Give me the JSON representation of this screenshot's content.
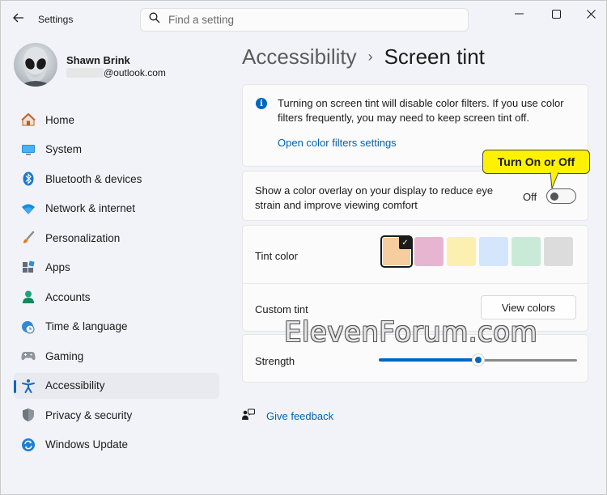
{
  "window": {
    "app_title": "Settings",
    "controls": [
      "minimize",
      "maximize",
      "close"
    ]
  },
  "search": {
    "placeholder": "Find a setting"
  },
  "profile": {
    "name": "Shawn Brink",
    "email": "@outlook.com"
  },
  "sidebar": {
    "items": [
      {
        "label": "Home",
        "icon": "home-icon",
        "active": false
      },
      {
        "label": "System",
        "icon": "system-icon",
        "active": false
      },
      {
        "label": "Bluetooth & devices",
        "icon": "bluetooth-icon",
        "active": false
      },
      {
        "label": "Network & internet",
        "icon": "wifi-icon",
        "active": false
      },
      {
        "label": "Personalization",
        "icon": "brush-icon",
        "active": false
      },
      {
        "label": "Apps",
        "icon": "apps-icon",
        "active": false
      },
      {
        "label": "Accounts",
        "icon": "person-icon",
        "active": false
      },
      {
        "label": "Time & language",
        "icon": "clock-globe-icon",
        "active": false
      },
      {
        "label": "Gaming",
        "icon": "gamepad-icon",
        "active": false
      },
      {
        "label": "Accessibility",
        "icon": "accessibility-icon",
        "active": true
      },
      {
        "label": "Privacy & security",
        "icon": "shield-icon",
        "active": false
      },
      {
        "label": "Windows Update",
        "icon": "update-icon",
        "active": false
      }
    ]
  },
  "breadcrumb": {
    "parent": "Accessibility",
    "separator": "›",
    "current": "Screen tint"
  },
  "info": {
    "text": "Turning on screen tint will disable color filters. If you use color filters frequently, you may need to keep screen tint off.",
    "link": "Open color filters settings"
  },
  "overlay": {
    "text": "Show a color overlay on your display to reduce eye strain and improve viewing comfort",
    "state_label": "Off",
    "enabled": false
  },
  "tint": {
    "label": "Tint color",
    "swatches": [
      "#f6cd9e",
      "#e7b5cf",
      "#fbf0b0",
      "#d3e6fc",
      "#c9ead7",
      "#dcdcdc"
    ],
    "selected_index": 0
  },
  "custom_tint": {
    "label": "Custom tint",
    "button": "View colors"
  },
  "strength": {
    "label": "Strength",
    "value": 0.5
  },
  "feedback": {
    "label": "Give feedback"
  },
  "annotation": {
    "callout": "Turn On or Off"
  },
  "watermark": {
    "text": "ElevenForum.com"
  },
  "colors": {
    "accent": "#0067c0",
    "callout_bg": "#fff200"
  }
}
